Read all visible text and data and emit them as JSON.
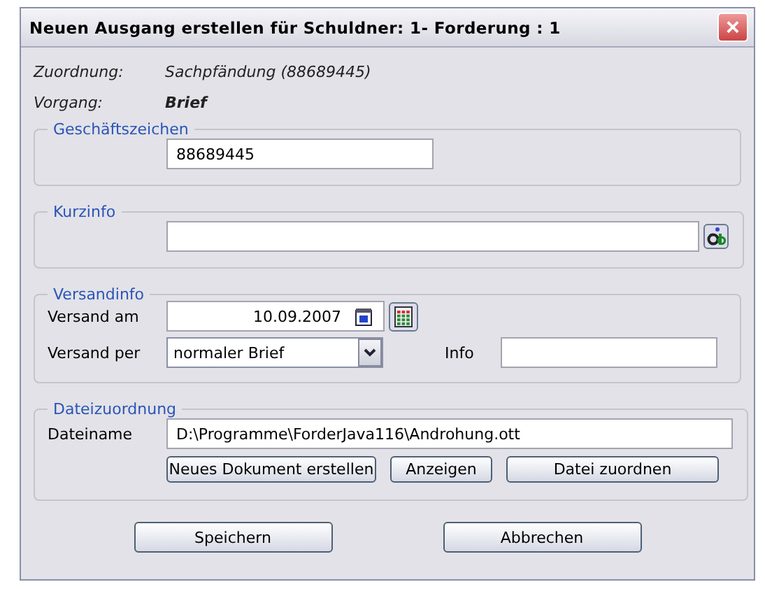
{
  "window": {
    "title": "Neuen Ausgang erstellen für Schuldner: 1- Forderung : 1",
    "close": "×"
  },
  "info": [
    {
      "label": "Zuordnung:",
      "value": "Sachpfändung (88689445)",
      "bold": false
    },
    {
      "label": "Vorgang:",
      "value": "Brief",
      "bold": true
    }
  ],
  "geschaeftszeichen": {
    "title": "Geschäftszeichen",
    "value": "88689445"
  },
  "kurzinfo": {
    "title": "Kurzinfo"
  },
  "versandinfo": {
    "title": "Versandinfo",
    "date_label": "Versand am",
    "date": "10.09.2007",
    "per_label": "Versand per",
    "per": "normaler Brief",
    "info_label": "Info"
  },
  "dateizuordnung": {
    "title": "Dateizuordnung",
    "file_label": "Dateiname",
    "file": "D:\\Programme\\ForderJava116\\Androhung.ott",
    "buttons": [
      "Neues Dokument erstellen",
      "Anzeigen",
      "Datei zuordnen"
    ]
  },
  "buttons": [
    "Speichern",
    "Abbrechen"
  ]
}
